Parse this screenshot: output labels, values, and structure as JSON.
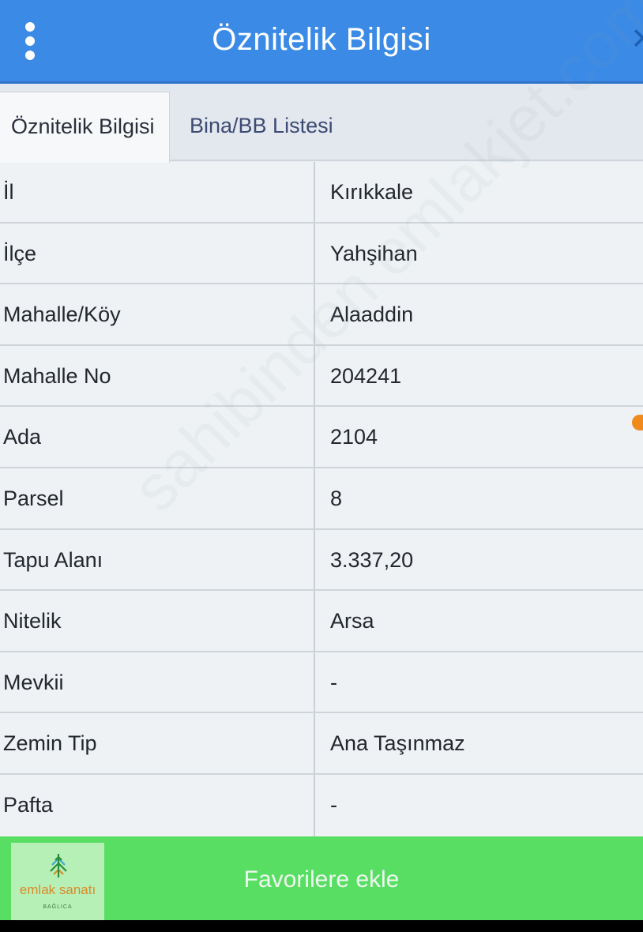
{
  "header": {
    "title": "Öznitelik Bilgisi",
    "menu_icon": "more-vertical-icon",
    "close_icon": "close-icon"
  },
  "tabs": [
    {
      "label": "Öznitelik Bilgisi",
      "active": true
    },
    {
      "label": "Bina/BB Listesi",
      "active": false
    }
  ],
  "rows": [
    {
      "label": "İl",
      "value": "Kırıkkale"
    },
    {
      "label": "İlçe",
      "value": "Yahşihan"
    },
    {
      "label": "Mahalle/Köy",
      "value": "Alaaddin"
    },
    {
      "label": "Mahalle No",
      "value": "204241"
    },
    {
      "label": "Ada",
      "value": "2104"
    },
    {
      "label": "Parsel",
      "value": "8"
    },
    {
      "label": "Tapu Alanı",
      "value": "3.337,20"
    },
    {
      "label": "Nitelik",
      "value": "Arsa"
    },
    {
      "label": "Mevkii",
      "value": "-"
    },
    {
      "label": "Zemin Tip",
      "value": "Ana Taşınmaz"
    },
    {
      "label": "Pafta",
      "value": "-"
    }
  ],
  "footer": {
    "button_label": "Favorilere ekle",
    "logo_text": "emlak sanatı",
    "logo_subtext": "BAĞLICA"
  },
  "watermark": {
    "text": "sahibinden emlakjet.com"
  },
  "colors": {
    "header": "#3b8be6",
    "footer": "#58de63",
    "accent_dot": "#f08a1c"
  }
}
